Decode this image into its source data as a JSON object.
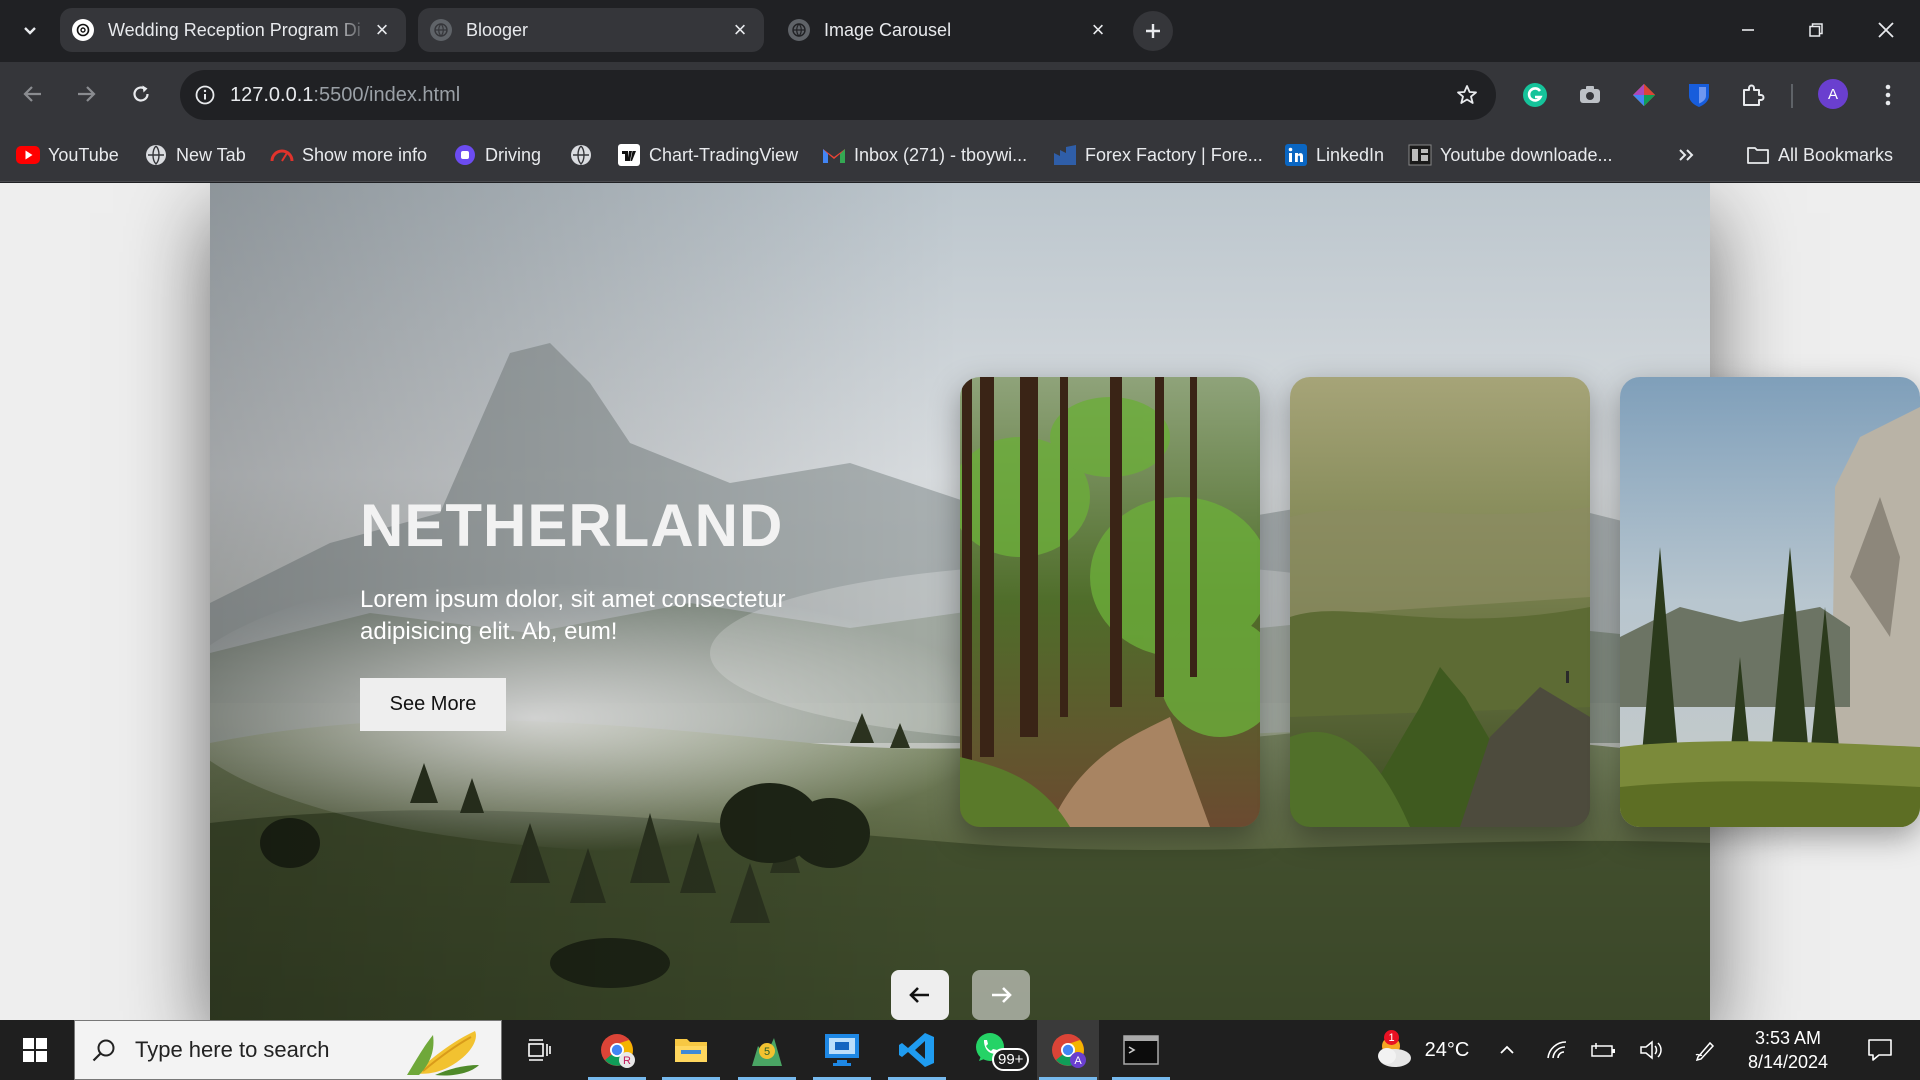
{
  "browser": {
    "tabs": [
      {
        "title": "Wedding Reception Program Di",
        "active": false
      },
      {
        "title": "Blooger",
        "active": false
      },
      {
        "title": "Image Carousel",
        "active": true
      }
    ],
    "address": {
      "host": "127.0.0.1",
      "path": ":5500/index.html"
    },
    "bookmarks": [
      {
        "label": "YouTube",
        "icon": "youtube-icon"
      },
      {
        "label": "New Tab",
        "icon": "globe-icon"
      },
      {
        "label": "Show more info",
        "icon": "speedometer-icon"
      },
      {
        "label": "Driving",
        "icon": "driving-icon"
      },
      {
        "label": "",
        "icon": "globe-icon"
      },
      {
        "label": "Chart-TradingView",
        "icon": "tradingview-icon"
      },
      {
        "label": "Inbox (271) - tboywi...",
        "icon": "gmail-icon"
      },
      {
        "label": "Forex Factory | Fore...",
        "icon": "forex-factory-icon"
      },
      {
        "label": "LinkedIn",
        "icon": "linkedin-icon"
      },
      {
        "label": "Youtube downloade...",
        "icon": "downloader-icon"
      }
    ],
    "all_bookmarks_label": "All Bookmarks",
    "profile_initial": "A"
  },
  "page": {
    "hero": {
      "title": "NETHERLAND",
      "description": "Lorem ipsum dolor, sit amet consectetur adipisicing elit. Ab, eum!",
      "button_label": "See More"
    },
    "thumbnails": [
      {
        "name": "forest-path"
      },
      {
        "name": "mountain-valley"
      },
      {
        "name": "rock-cliff-meadow"
      }
    ],
    "controls": {
      "prev_symbol": "←",
      "next_symbol": "→"
    }
  },
  "taskbar": {
    "search_placeholder": "Type here to search",
    "weather": {
      "temperature": "24°C",
      "alert_count": "1"
    },
    "whatsapp_badge": "99+",
    "time": "3:53 AM",
    "date": "8/14/2024"
  },
  "colors": {
    "tab_bar": "#202124",
    "toolbar": "#35363a",
    "page_bg": "#eeeeee",
    "taskbar": "#1f1f1f",
    "accent_blue": "#76b9ed",
    "profile_purple": "#6a3fcf"
  }
}
